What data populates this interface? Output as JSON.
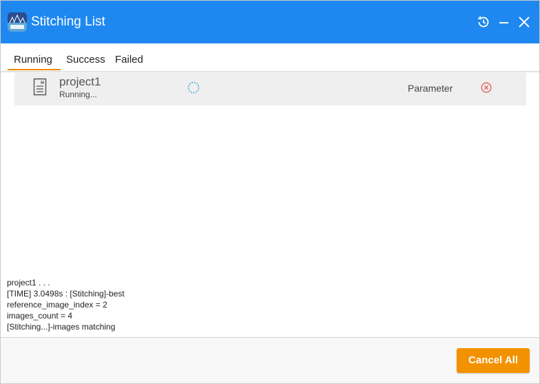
{
  "window": {
    "title": "Stitching List",
    "controls": [
      "history-icon",
      "minimize-icon",
      "close-icon"
    ]
  },
  "tabs": [
    {
      "label": "Running",
      "active": true
    },
    {
      "label": "Success",
      "active": false
    },
    {
      "label": "Failed",
      "active": false
    }
  ],
  "tasks": [
    {
      "name": "project1",
      "status": "Running...",
      "param_label": "Parameter",
      "icons": [
        "document-icon",
        "loading-spinner-icon",
        "cancel-circle-icon"
      ]
    }
  ],
  "log": [
    "project1 . . .",
    "[TIME] 3.0498s : [Stitching]-best",
    "reference_image_index = 2",
    "images_count = 4",
    "[Stitching...]-images matching"
  ],
  "footer": {
    "cancel_all_label": "Cancel All"
  },
  "colors": {
    "titlebar": "#1e88f0",
    "accent": "#f08c00",
    "button": "#f39200",
    "cancel_icon": "#e2554f",
    "spinner": "#3aa0e0"
  }
}
